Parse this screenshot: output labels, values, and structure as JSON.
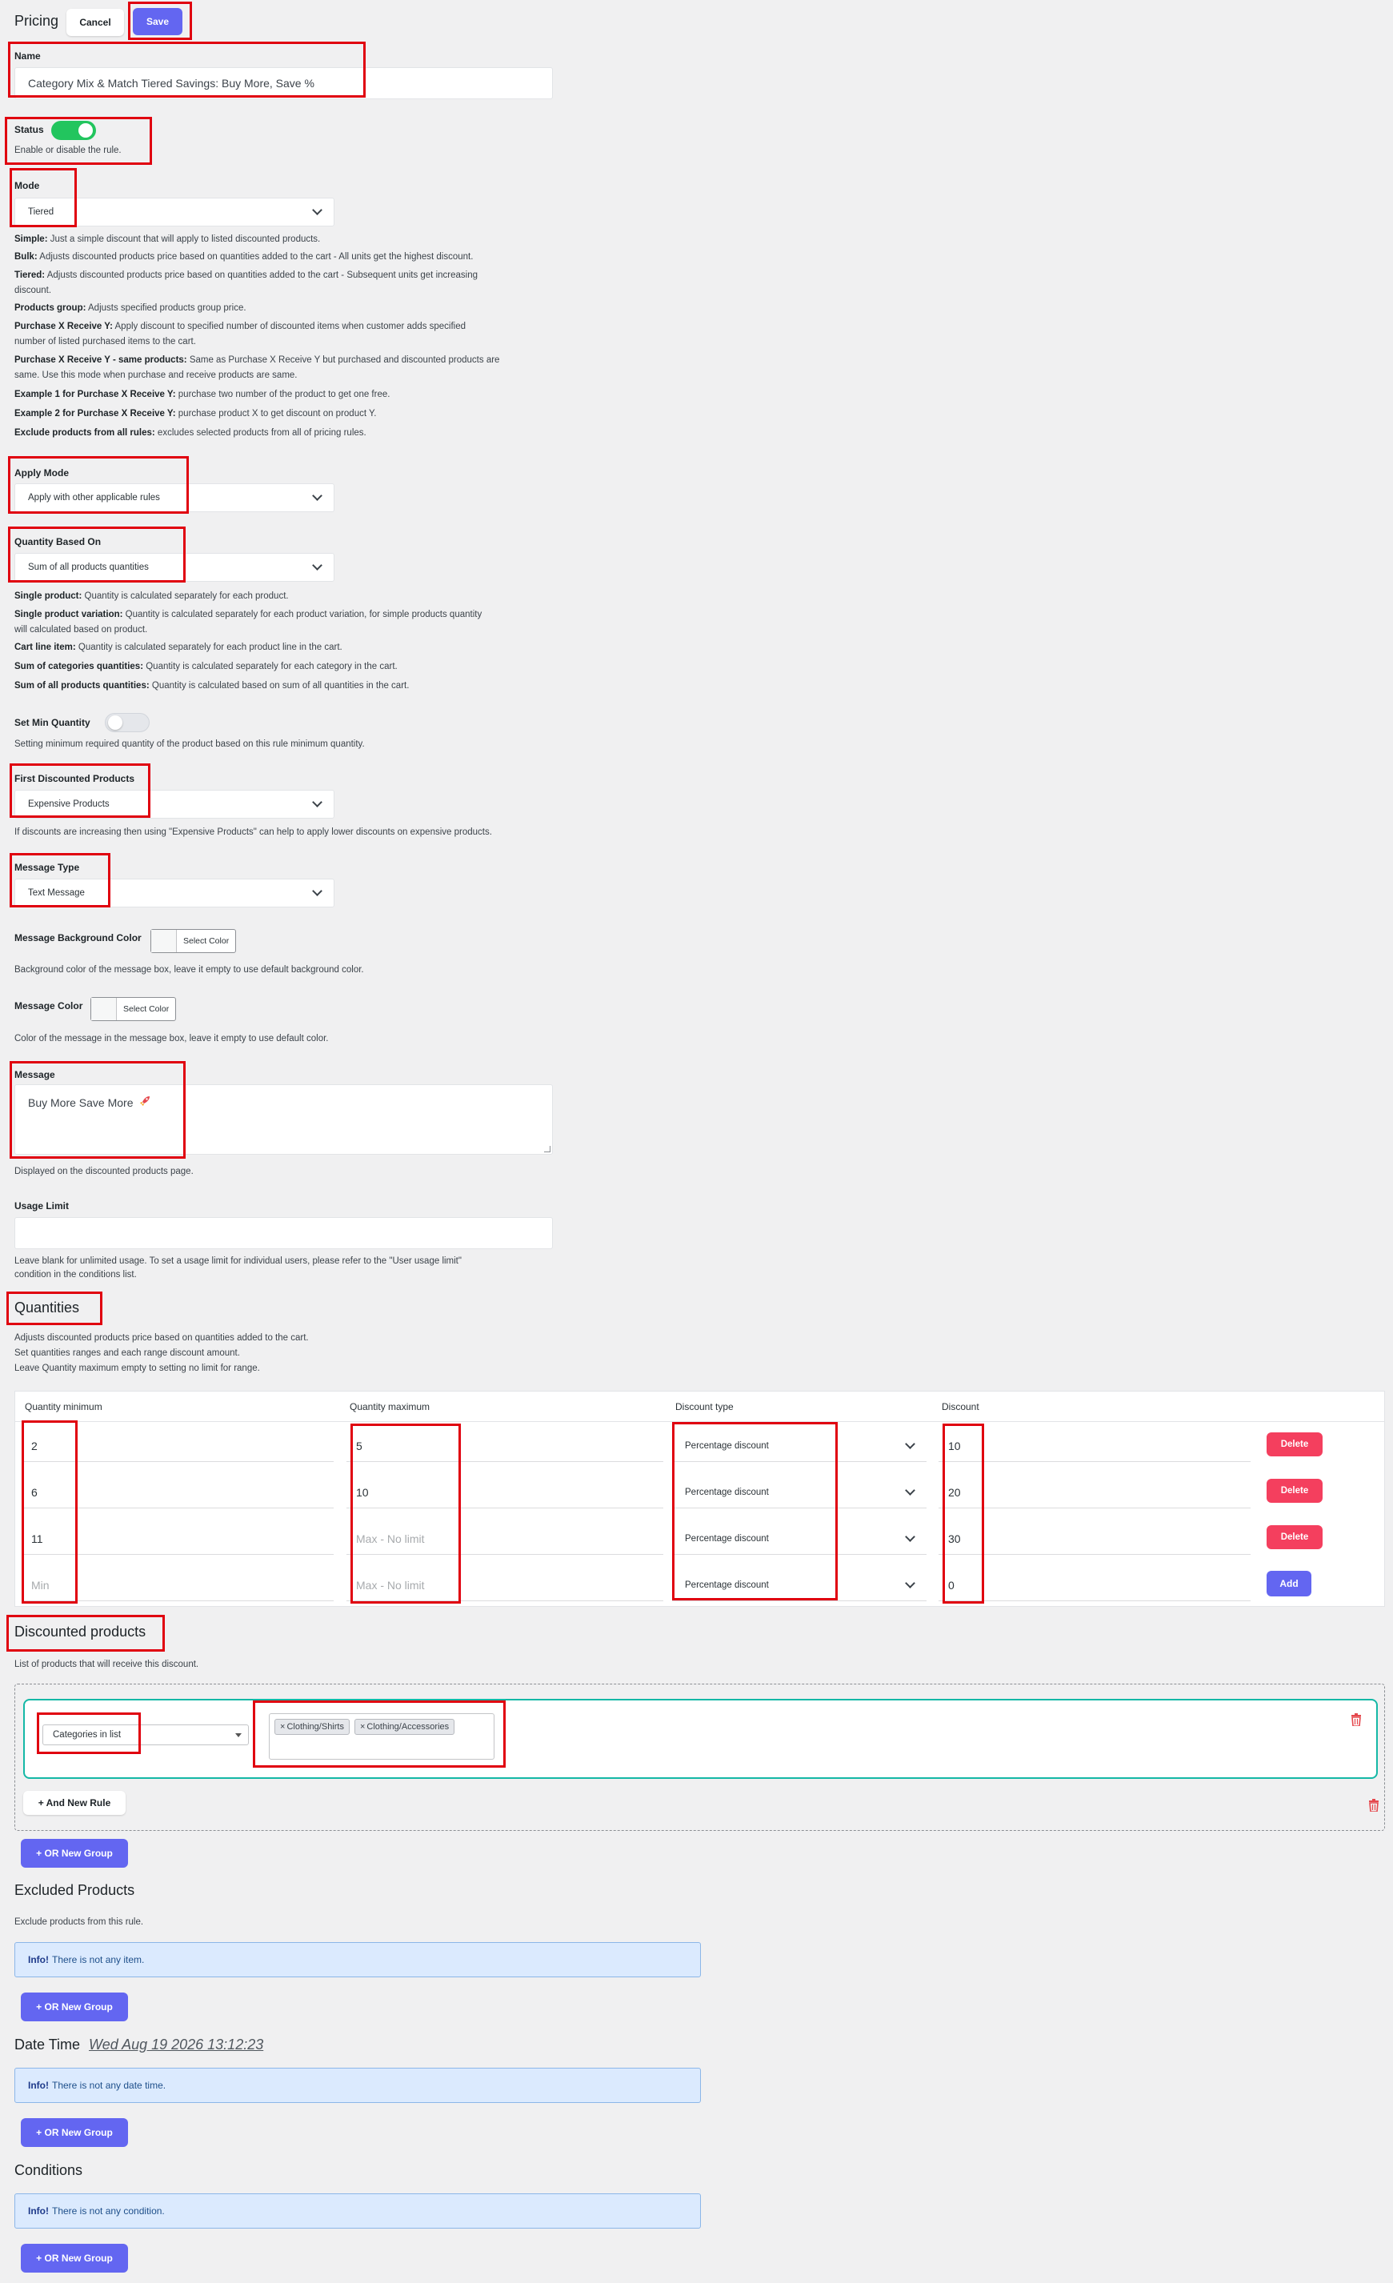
{
  "header": {
    "title": "Pricing",
    "cancel_label": "Cancel",
    "save_label": "Save"
  },
  "name": {
    "label": "Name",
    "value": "Category Mix & Match Tiered Savings: Buy More, Save %"
  },
  "status": {
    "label": "Status",
    "desc": "Enable or disable the rule.",
    "enabled": true,
    "on_color": "#22c55e"
  },
  "mode": {
    "label": "Mode",
    "value": "Tiered",
    "help": [
      {
        "term": "Simple:",
        "text": " Just a simple discount that will apply to listed discounted products."
      },
      {
        "term": "Bulk:",
        "text": " Adjusts discounted products price based on quantities added to the cart - All units get the highest discount."
      },
      {
        "term": "Tiered:",
        "text": " Adjusts discounted products price based on quantities added to the cart - Subsequent units get increasing"
      },
      {
        "term": "",
        "text": "discount."
      },
      {
        "term": "Products group:",
        "text": " Adjusts specified products group price."
      },
      {
        "term": "Purchase X Receive Y:",
        "text": " Apply discount to specified number of discounted items when customer adds specified"
      },
      {
        "term": "",
        "text": "number of listed purchased items to the cart."
      },
      {
        "term": "Purchase X Receive Y - same products:",
        "text": " Same as Purchase X Receive Y but purchased and discounted products are"
      },
      {
        "term": "",
        "text": "same. Use this mode when purchase and receive products are same."
      },
      {
        "term": "Example 1 for Purchase X Receive Y:",
        "text": " purchase two number of the product to get one free."
      },
      {
        "term": "Example 2 for Purchase X Receive Y:",
        "text": " purchase product X to get discount on product Y."
      },
      {
        "term": "Exclude products from all rules:",
        "text": " excludes selected products from all of pricing rules."
      }
    ]
  },
  "apply_mode": {
    "label": "Apply Mode",
    "value": "Apply with other applicable rules"
  },
  "quantity_based_on": {
    "label": "Quantity Based On",
    "value": "Sum of all products quantities",
    "help": [
      {
        "term": "Single product:",
        "text": " Quantity is calculated separately for each product."
      },
      {
        "term": "Single product variation:",
        "text": " Quantity is calculated separately for each product variation, for simple products quantity"
      },
      {
        "term": "",
        "text": "will calculated based on product."
      },
      {
        "term": "Cart line item:",
        "text": " Quantity is calculated separately for each product line in the cart."
      },
      {
        "term": "Sum of categories quantities:",
        "text": " Quantity is calculated separately for each category in the cart."
      },
      {
        "term": "Sum of all products quantities:",
        "text": " Quantity is calculated based on sum of all quantities in the cart."
      }
    ]
  },
  "set_min_quantity": {
    "label": "Set Min Quantity",
    "desc": "Setting minimum required quantity of the product based on this rule minimum quantity.",
    "enabled": false
  },
  "first_discounted": {
    "label": "First Discounted Products",
    "value": "Expensive Products",
    "desc": "If discounts are increasing then using \"Expensive Products\" can help to apply lower discounts on expensive products."
  },
  "message_type": {
    "label": "Message Type",
    "value": "Text Message"
  },
  "message_bg_color": {
    "label": "Message Background Color",
    "button": "Select Color",
    "desc": "Background color of the message box, leave it empty to use default background color."
  },
  "message_color": {
    "label": "Message Color",
    "button": "Select Color",
    "desc": "Color of the message in the message box, leave it empty to use default color."
  },
  "message": {
    "label": "Message",
    "value": "Buy More Save More",
    "desc": "Displayed on the discounted products page.",
    "icon": "rocket-icon"
  },
  "usage_limit": {
    "label": "Usage Limit",
    "value": "",
    "desc_1": "Leave blank for unlimited usage. To set a usage limit for individual users, please refer to the \"User usage limit\"",
    "desc_2": "condition in the conditions list."
  },
  "quantities": {
    "title": "Quantities",
    "desc": [
      "Adjusts discounted products price based on quantities added to the cart.",
      "Set quantities ranges and each range discount amount.",
      "Leave Quantity maximum empty to setting no limit for range."
    ],
    "headers": {
      "min": "Quantity minimum",
      "max": "Quantity maximum",
      "type": "Discount type",
      "discount": "Discount"
    },
    "rows": [
      {
        "min": "2",
        "max": "5",
        "type": "Percentage discount",
        "discount": "10",
        "action": "Delete"
      },
      {
        "min": "6",
        "max": "10",
        "type": "Percentage discount",
        "discount": "20",
        "action": "Delete"
      },
      {
        "min": "11",
        "max": "",
        "type": "Percentage discount",
        "discount": "30",
        "action": "Delete"
      },
      {
        "min": "",
        "max": "",
        "type": "Percentage discount",
        "discount": "0",
        "action": "Add"
      }
    ],
    "min_placeholder": "Min",
    "max_placeholder": "Max - No limit"
  },
  "discounted_products": {
    "title": "Discounted products",
    "desc": "List of products that will receive this discount.",
    "rule_type": "Categories in list",
    "tags": [
      "Clothing/Shirts",
      "Clothing/Accessories"
    ],
    "and_rule": "+ And New Rule",
    "or_group": "+ OR New Group"
  },
  "excluded_products": {
    "title": "Excluded Products",
    "desc": "Exclude products from this rule.",
    "info_strong": "Info!",
    "info_text": "There is not any item.",
    "or_group": "+ OR New Group"
  },
  "date_time": {
    "title": "Date Time",
    "date": "Wed Aug 19 2026 13:12:23",
    "info_strong": "Info!",
    "info_text": "There is not any date time.",
    "or_group": "+ OR New Group"
  },
  "conditions": {
    "title": "Conditions",
    "info_strong": "Info!",
    "info_text": "There is not any condition.",
    "or_group": "+ OR New Group"
  }
}
